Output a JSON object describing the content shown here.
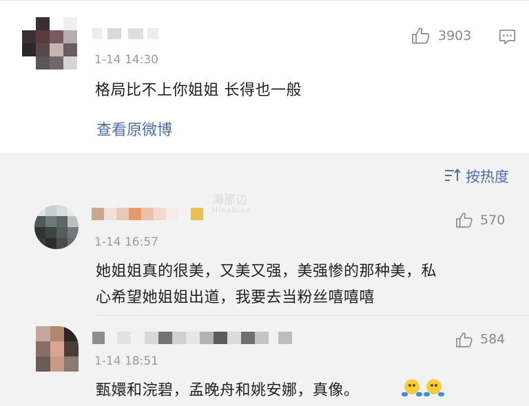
{
  "main_comment": {
    "time": "1-14 14:30",
    "content": "格局比不上你姐姐 长得也一般",
    "likes": "3903",
    "view_original_link": "查看原微博"
  },
  "sort_control": {
    "label": "按热度"
  },
  "watermark": {
    "cn": "海那边",
    "en": "Hinabian"
  },
  "replies": [
    {
      "time": "1-14 16:57",
      "content_line1": "她姐姐真的很美，又美又强，美强惨的那种美，私",
      "content_line2": "心希望她姐姐出道，我要去当粉丝嘻嘻嘻",
      "likes": "570"
    },
    {
      "time": "1-14 18:51",
      "content": "甄嬛和浣碧，孟晚舟和姚安娜，真像。",
      "likes": "584",
      "emoji_count": 2
    }
  ],
  "icons": {
    "like": "thumbs-up-icon",
    "comment": "comment-icon",
    "sort": "sort-icon",
    "emoji": "emoji-icon"
  },
  "colors": {
    "link": "#4a6fa5",
    "timestamp": "#9b9b9b",
    "text": "#1f1f1f",
    "icon": "#8a8a8a",
    "reply_background": "#f2f2f2"
  }
}
